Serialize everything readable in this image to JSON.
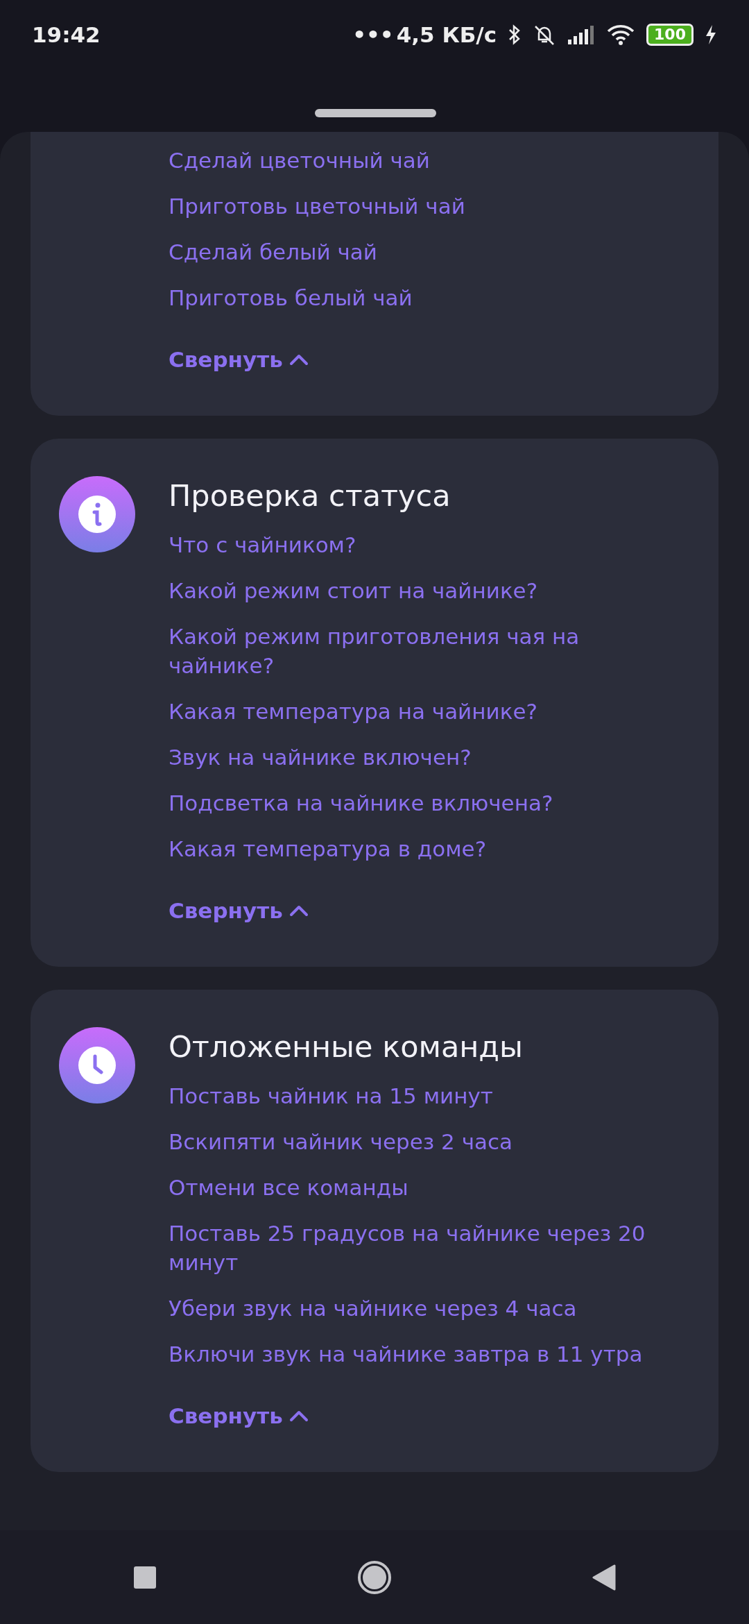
{
  "status_bar": {
    "time": "19:42",
    "dots": "•••",
    "net_speed": "4,5 КБ/с",
    "battery": "100"
  },
  "sections": [
    {
      "kind": "plain",
      "commands": [
        "Сделай цветочный чай",
        "Приготовь цветочный чай",
        "Сделай белый чай",
        "Приготовь белый чай"
      ],
      "collapse_label": "Свернуть",
      "expanded": true
    },
    {
      "kind": "info",
      "title": "Проверка статуса",
      "commands": [
        "Что с чайником?",
        "Какой режим стоит на чайнике?",
        "Какой режим приготовления чая на чайнике?",
        "Какая температура на чайнике?",
        "Звук на чайнике включен?",
        "Подсветка на чайнике включена?",
        "Какая температура в доме?"
      ],
      "collapse_label": "Свернуть",
      "expanded": true
    },
    {
      "kind": "clock",
      "title": "Отложенные команды",
      "commands": [
        "Поставь чайник на 15 минут",
        "Вскипяти чайник через 2 часа",
        "Отмени все команды",
        "Поставь 25 градусов на чайнике через 20 минут",
        "Убери звук на чайнике через 4 часа",
        "Включи звук на чайнике завтра в 11 утра"
      ],
      "collapse_label": "Свернуть",
      "expanded": true
    }
  ]
}
